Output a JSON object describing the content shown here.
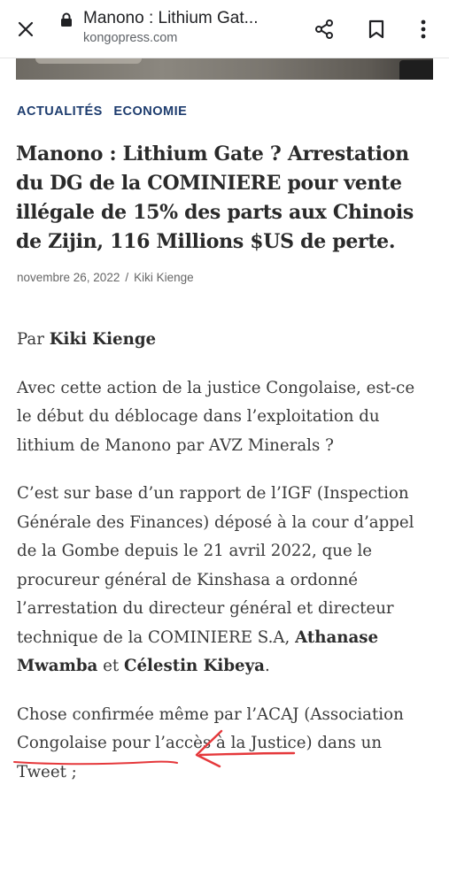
{
  "browser": {
    "title": "Manono : Lithium Gat...",
    "url": "kongopress.com"
  },
  "article": {
    "categories": [
      "ACTUALITÉS",
      "ECONOMIE"
    ],
    "headline": "Manono : Lithium Gate ? Arrestation du DG de la COMINIERE pour vente illégale de 15% des parts aux Chinois de Zijin, 116 Millions $US de perte.",
    "date": "novembre 26, 2022",
    "separator": "/",
    "author": "Kiki Kienge",
    "byline_prefix": "Par ",
    "byline_name": "Kiki Kienge",
    "p1": "Avec cette action de la justice Congolaise, est-ce le début du déblocage dans l’exploitation du lithium de Manono par AVZ Minerals ?",
    "p2_text": "C’est sur base d’un rapport de l’IGF (Inspection Générale des Finances) déposé à la cour d’appel de la Gombe depuis le 21 avril 2022, que le procureur général de Kinshasa a ordonné l’arrestation du directeur général et directeur technique de la COMINIERE S.A, ",
    "p2_name1": "Athanase Mwamba",
    "p2_and": " et ",
    "p2_name2": "Célestin Kibeya",
    "p2_end": ".",
    "p3": "Chose confirmée même par l’ACAJ (Association Congolaise pour l’accès à la Justice) dans un Tweet ;"
  },
  "annotation_color": "#e5383b",
  "icons": [
    "close-icon",
    "lock-icon",
    "share-icon",
    "bookmark-icon",
    "more-vert-icon"
  ]
}
